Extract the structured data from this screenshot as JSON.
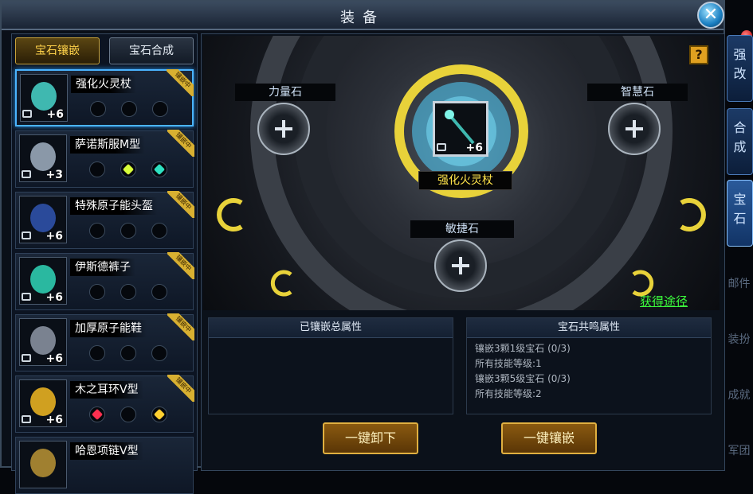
{
  "window": {
    "title": "装备"
  },
  "left_tabs": {
    "inlay": "宝石镶嵌",
    "synth": "宝石合成"
  },
  "items": [
    {
      "name": "强化火灵杖",
      "level": "+6",
      "ribbon": "镶嵌中",
      "gems": [
        "",
        "",
        ""
      ],
      "icon": "staff-icon"
    },
    {
      "name": "萨诺斯服M型",
      "level": "+3",
      "ribbon": "镶嵌中",
      "gems": [
        "",
        "#d8ff3a",
        "#2ee0c0"
      ],
      "icon": "armor-icon"
    },
    {
      "name": "特殊原子能头盔",
      "level": "+6",
      "ribbon": "镶嵌中",
      "gems": [
        "",
        "",
        ""
      ],
      "icon": "helmet-icon"
    },
    {
      "name": "伊斯德裤子",
      "level": "+6",
      "ribbon": "镶嵌中",
      "gems": [
        "",
        "",
        ""
      ],
      "icon": "pants-icon"
    },
    {
      "name": "加厚原子能鞋",
      "level": "+6",
      "ribbon": "镶嵌中",
      "gems": [
        "",
        "",
        ""
      ],
      "icon": "boots-icon"
    },
    {
      "name": "木之耳环V型",
      "level": "+6",
      "ribbon": "镶嵌中",
      "gems": [
        "#ff3050",
        "",
        "#ffd030"
      ],
      "icon": "earring-icon"
    },
    {
      "name": "哈恩项链V型",
      "level": "",
      "ribbon": "",
      "gems": [],
      "icon": "necklace-icon"
    }
  ],
  "stones": {
    "strength": "力量石",
    "wisdom": "智慧石",
    "agility": "敏捷石"
  },
  "center": {
    "name": "强化火灵杖",
    "level": "+6"
  },
  "help_label": "?",
  "obtain_link": "获得途径",
  "total_attr": {
    "title": "已镶嵌总属性",
    "lines": []
  },
  "resonance": {
    "title": "宝石共鸣属性",
    "lines": [
      "镶嵌3颗1级宝石 (0/3)",
      "所有技能等级:1",
      "镶嵌3颗5级宝石 (0/3)",
      "所有技能等级:2"
    ]
  },
  "buttons": {
    "unload": "一键卸下",
    "inlay": "一键镶嵌"
  },
  "side_tabs": {
    "enhance": [
      "强",
      "改"
    ],
    "synth": [
      "合",
      "成"
    ],
    "gem": [
      "宝",
      "石"
    ]
  },
  "side_dim": {
    "mail": "邮件",
    "outfit": "装扮",
    "achievement": "成就",
    "legion": "军团"
  },
  "colors": {
    "accent": "#ffe44a",
    "link": "#3cff3c",
    "selected_border": "#4ab4ff"
  }
}
